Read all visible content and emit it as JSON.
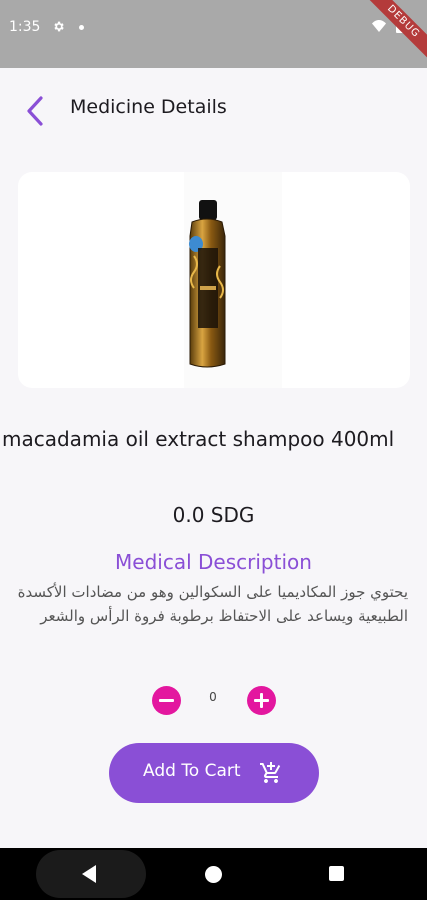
{
  "status_bar": {
    "time": "1:35",
    "debug_label": "DEBUG"
  },
  "app_bar": {
    "title": "Medicine Details",
    "back_icon": "chevron-left-icon"
  },
  "product": {
    "name": "macadamia oil extract shampoo 400ml",
    "price": "0.0 SDG",
    "description_title": "Medical Description",
    "description": "يحتوي جوز المكاديميا على السكوالين وهو من مضادات الأكسدة الطبيعية ويساعد على الاحتفاظ برطوبة فروة الرأس والشعر"
  },
  "quantity": {
    "value": "0"
  },
  "actions": {
    "add_to_cart_label": "Add To Cart",
    "cart_icon": "add-shopping-cart-icon"
  },
  "colors": {
    "accent": "#8a4fd6",
    "stepper": "#e3179f",
    "status_bar": "#a9a9a9"
  }
}
